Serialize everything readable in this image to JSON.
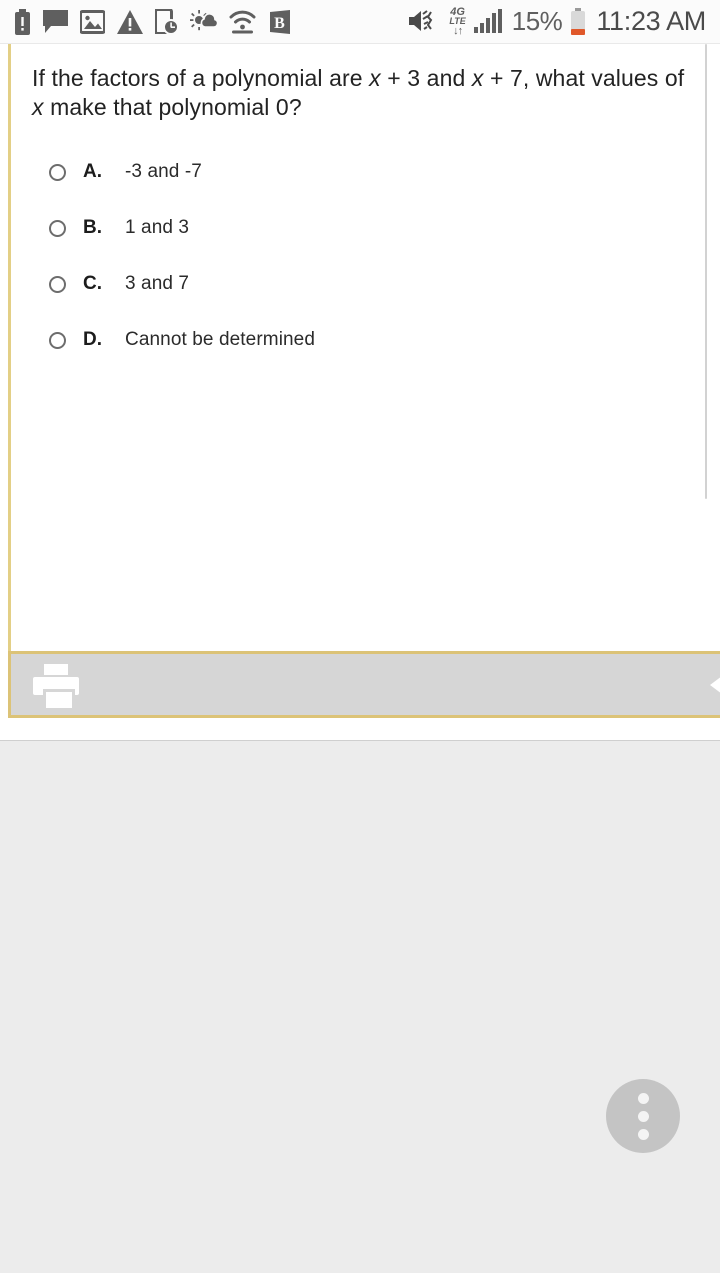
{
  "status_bar": {
    "left_icons": [
      {
        "name": "battery-alert-icon",
        "glyph": "battery-alert"
      },
      {
        "name": "message-icon",
        "glyph": "message"
      },
      {
        "name": "image-icon",
        "glyph": "image"
      },
      {
        "name": "warning-icon",
        "glyph": "warning"
      },
      {
        "name": "device-clock-icon",
        "glyph": "device-clock"
      },
      {
        "name": "weather-icon",
        "glyph": "sun-cloud"
      },
      {
        "name": "wifi-hotspot-icon",
        "glyph": "wifi"
      },
      {
        "name": "app-badge-b-icon",
        "glyph": "B"
      }
    ],
    "mute_icon": "volume-mute-vibrate-icon",
    "network": {
      "label_top": "4G",
      "label_mid": "LTE",
      "label_bottom": "↓↑"
    },
    "signal_icon": "signal-bars-icon",
    "battery_percent": "15%",
    "battery_icon": "battery-low-icon",
    "time": "11:23 AM"
  },
  "question_card": {
    "question_parts": [
      {
        "text": "If the factors of a polynomial are ",
        "italic": false
      },
      {
        "text": "x",
        "italic": true
      },
      {
        "text": " + 3 and ",
        "italic": false
      },
      {
        "text": "x",
        "italic": true
      },
      {
        "text": " + 7, what values of ",
        "italic": false
      },
      {
        "text": "x",
        "italic": true
      },
      {
        "text": " make that polynomial 0?",
        "italic": false
      }
    ],
    "question_plain": "If the factors of a polynomial are x + 3 and x + 7, what values of x make that polynomial 0?",
    "options": [
      {
        "letter": "A.",
        "text": "-3 and -7",
        "selected": false
      },
      {
        "letter": "B.",
        "text": "1 and 3",
        "selected": false
      },
      {
        "letter": "C.",
        "text": "3 and 7",
        "selected": false
      },
      {
        "letter": "D.",
        "text": "Cannot be determined",
        "selected": false
      }
    ]
  },
  "toolbar": {
    "print_icon": "printer-icon",
    "next_arrow_icon": "arrow-left-icon"
  },
  "fab": {
    "icon": "overflow-menu-icon"
  },
  "colors": {
    "card_accent": "#dcc377",
    "toolbar_bg": "#d6d6d6",
    "page_bg": "#ececec",
    "fab_bg": "#c4c4c4",
    "status_icon": "#5f5f5f",
    "battery_low": "#e0582a"
  }
}
